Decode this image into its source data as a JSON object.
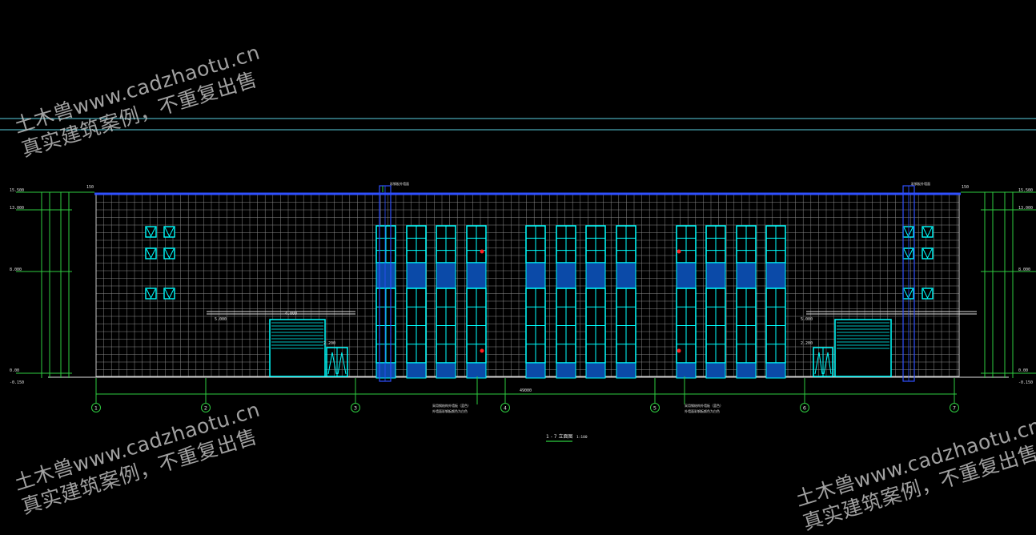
{
  "drawing": {
    "title": "1 - 7 立面图",
    "scale": "1:100",
    "total_dimension": "49000",
    "axis_labels": [
      "1",
      "2",
      "3",
      "4",
      "5",
      "6",
      "7"
    ],
    "elevations_left": [
      "15.500",
      "13.000",
      "8.000",
      "0.00",
      "-0.150"
    ],
    "elevations_right": [
      "15.500",
      "13.000",
      "8.000",
      "0.00",
      "-0.150"
    ],
    "canopy_levels": {
      "left": "5.000",
      "right": "5.000"
    },
    "door_heights": {
      "left": "2.200",
      "right": "2.200"
    },
    "roller_door_width": "4.000",
    "parapet_note": "150",
    "notes": {
      "top_left": "彩钢板外墙面",
      "top_right": "彩钢板外墙面",
      "bottom_left_1": "采用钢结构外墙板（蓝色）",
      "bottom_left_2": "外墙面彩钢板颜色为白色",
      "bottom_right_1": "采用钢结构外墙板（蓝色）",
      "bottom_right_2": "外墙面彩钢板颜色为白色"
    },
    "colors": {
      "background": "#000000",
      "cyan": "#00ffff",
      "blue_panel": "#0b4aa8",
      "green": "#2ecc40",
      "grid": "#8a8a8a",
      "red": "#ff2020",
      "roof": "#2f50ff"
    }
  },
  "watermarks": [
    {
      "line1": "土木兽www.cadzhaotu.cn",
      "line2": "真实建筑案例，不重复出售"
    },
    {
      "line1": "土木兽www.cadzhaotu.cn",
      "line2": "真实建筑案例，不重复出售"
    },
    {
      "line1": "土木兽www.cadzhaotu.cn",
      "line2": "真实建筑案例，不重复出售"
    }
  ]
}
